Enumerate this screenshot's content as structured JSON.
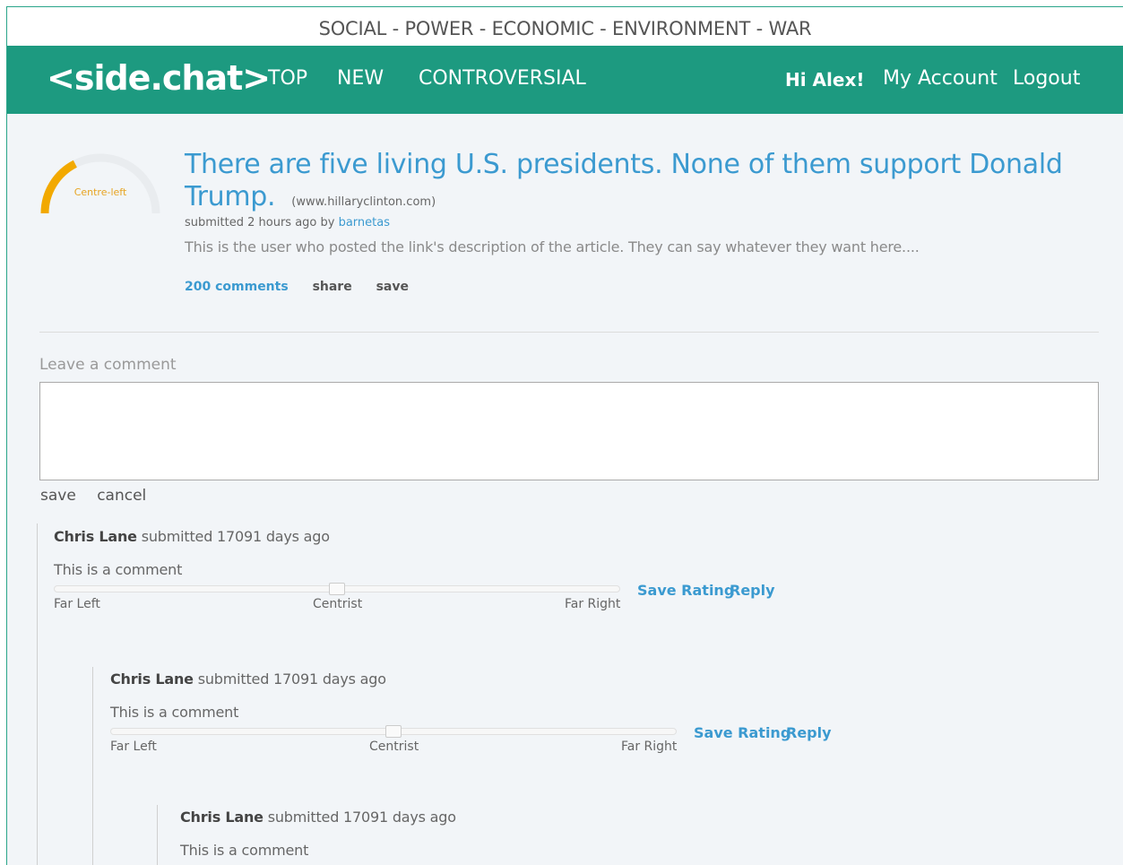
{
  "topics_bar": "SOCIAL - POWER - ECONOMIC - ENVIRONMENT - WAR",
  "header": {
    "logo": "<side.chat>",
    "nav": [
      "TOP",
      "NEW",
      "CONTROVERSIAL"
    ],
    "greeting": "Hi Alex!",
    "my_account": "My Account",
    "logout": "Logout"
  },
  "post": {
    "gauge_label": "Centre-left",
    "gauge_level": 0.35,
    "gauge_color": "#f2a900",
    "title": "There are five living U.S. presidents. None of them support Donald Trump.",
    "domain": "(www.hillaryclinton.com)",
    "submitted_prefix": "submitted 2 hours ago by",
    "author": "barnetas",
    "description": "This is the user who posted the link's description of the article. They can say whatever they want here....",
    "comments_link": "200 comments",
    "share": "share",
    "save": "save"
  },
  "comment_form": {
    "label": "Leave a comment",
    "value": "",
    "save": "save",
    "cancel": "cancel"
  },
  "comments": [
    {
      "author": "Chris Lane",
      "meta": "submitted 17091 days ago",
      "text": "This is a comment",
      "scale_left": "Far Left",
      "scale_mid": "Centrist",
      "scale_right": "Far Right",
      "rating": 0.5,
      "save_rating": "Save Rating",
      "reply": "Reply"
    },
    {
      "author": "Chris Lane",
      "meta": "submitted 17091 days ago",
      "text": "This is a comment",
      "scale_left": "Far Left",
      "scale_mid": "Centrist",
      "scale_right": "Far Right",
      "rating": 0.5,
      "save_rating": "Save Rating",
      "reply": "Reply"
    },
    {
      "author": "Chris Lane",
      "meta": "submitted 17091 days ago",
      "text": "This is a comment"
    }
  ]
}
